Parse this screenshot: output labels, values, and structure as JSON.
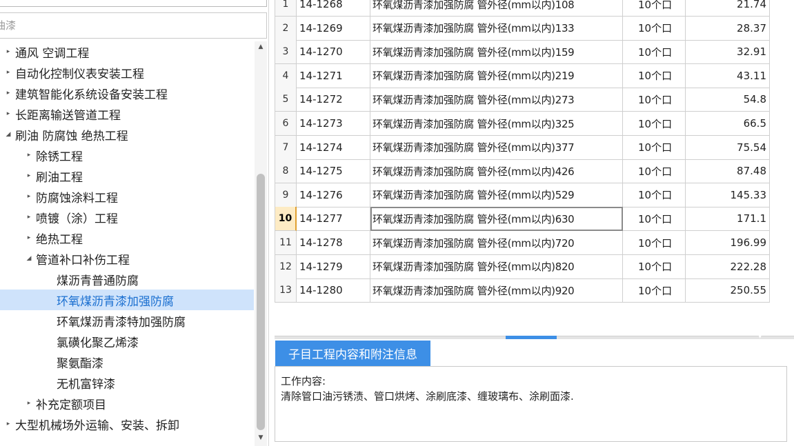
{
  "left_panel": {
    "filter_placeholder": "油漆",
    "tree": [
      {
        "label": "通风 空调工程",
        "arrow": "▸",
        "depth": 0,
        "selected": false
      },
      {
        "label": "自动化控制仪表安装工程",
        "arrow": "▸",
        "depth": 0,
        "selected": false
      },
      {
        "label": "建筑智能化系统设备安装工程",
        "arrow": "▸",
        "depth": 0,
        "selected": false
      },
      {
        "label": "长距离输送管道工程",
        "arrow": "▸",
        "depth": 0,
        "selected": false
      },
      {
        "label": "刷油 防腐蚀 绝热工程",
        "arrow": "◢",
        "depth": 0,
        "selected": false
      },
      {
        "label": "除锈工程",
        "arrow": "▸",
        "depth": 1,
        "selected": false
      },
      {
        "label": "刷油工程",
        "arrow": "▸",
        "depth": 1,
        "selected": false
      },
      {
        "label": "防腐蚀涂料工程",
        "arrow": "▸",
        "depth": 1,
        "selected": false
      },
      {
        "label": "喷镀（涂）工程",
        "arrow": "▸",
        "depth": 1,
        "selected": false
      },
      {
        "label": "绝热工程",
        "arrow": "▸",
        "depth": 1,
        "selected": false
      },
      {
        "label": "管道补口补伤工程",
        "arrow": "◢",
        "depth": 1,
        "selected": false
      },
      {
        "label": "煤沥青普通防腐",
        "arrow": "",
        "depth": 2,
        "selected": false
      },
      {
        "label": "环氧煤沥青漆加强防腐",
        "arrow": "",
        "depth": 2,
        "selected": true
      },
      {
        "label": "环氧煤沥青漆特加强防腐",
        "arrow": "",
        "depth": 2,
        "selected": false
      },
      {
        "label": "氯磺化聚乙烯漆",
        "arrow": "",
        "depth": 2,
        "selected": false
      },
      {
        "label": "聚氨酯漆",
        "arrow": "",
        "depth": 2,
        "selected": false
      },
      {
        "label": "无机富锌漆",
        "arrow": "",
        "depth": 2,
        "selected": false
      },
      {
        "label": "补充定额项目",
        "arrow": "▸",
        "depth": 1,
        "selected": false
      },
      {
        "label": "大型机械场外运输、安装、拆卸",
        "arrow": "▸",
        "depth": 0,
        "selected": false
      }
    ]
  },
  "table": {
    "active_row": 10,
    "rows": [
      {
        "idx": "1",
        "code": "14-1268",
        "name": "环氧煤沥青漆加强防腐 管外径(mm以内)108",
        "unit": "10个口",
        "price": "21.74"
      },
      {
        "idx": "2",
        "code": "14-1269",
        "name": "环氧煤沥青漆加强防腐 管外径(mm以内)133",
        "unit": "10个口",
        "price": "28.37"
      },
      {
        "idx": "3",
        "code": "14-1270",
        "name": "环氧煤沥青漆加强防腐 管外径(mm以内)159",
        "unit": "10个口",
        "price": "32.91"
      },
      {
        "idx": "4",
        "code": "14-1271",
        "name": "环氧煤沥青漆加强防腐 管外径(mm以内)219",
        "unit": "10个口",
        "price": "43.11"
      },
      {
        "idx": "5",
        "code": "14-1272",
        "name": "环氧煤沥青漆加强防腐 管外径(mm以内)273",
        "unit": "10个口",
        "price": "54.8"
      },
      {
        "idx": "6",
        "code": "14-1273",
        "name": "环氧煤沥青漆加强防腐 管外径(mm以内)325",
        "unit": "10个口",
        "price": "66.5"
      },
      {
        "idx": "7",
        "code": "14-1274",
        "name": "环氧煤沥青漆加强防腐 管外径(mm以内)377",
        "unit": "10个口",
        "price": "75.54"
      },
      {
        "idx": "8",
        "code": "14-1275",
        "name": "环氧煤沥青漆加强防腐 管外径(mm以内)426",
        "unit": "10个口",
        "price": "87.48"
      },
      {
        "idx": "9",
        "code": "14-1276",
        "name": "环氧煤沥青漆加强防腐 管外径(mm以内)529",
        "unit": "10个口",
        "price": "145.33"
      },
      {
        "idx": "10",
        "code": "14-1277",
        "name": "环氧煤沥青漆加强防腐 管外径(mm以内)630",
        "unit": "10个口",
        "price": "171.1"
      },
      {
        "idx": "11",
        "code": "14-1278",
        "name": "环氧煤沥青漆加强防腐 管外径(mm以内)720",
        "unit": "10个口",
        "price": "196.99"
      },
      {
        "idx": "12",
        "code": "14-1279",
        "name": "环氧煤沥青漆加强防腐 管外径(mm以内)820",
        "unit": "10个口",
        "price": "222.28"
      },
      {
        "idx": "13",
        "code": "14-1280",
        "name": "环氧煤沥青漆加强防腐 管外径(mm以内)920",
        "unit": "10个口",
        "price": "250.55"
      }
    ]
  },
  "info": {
    "tab_label": "子目工程内容和附注信息",
    "work_title": "工作内容:",
    "work_text": "清除管口油污锈渍、管口烘烤、涂刷底漆、缠玻璃布、涂刷面漆."
  },
  "icons": {
    "scroll_up": "▲",
    "scroll_down": "▼",
    "splitter": "▼"
  },
  "colors": {
    "accent": "#3d8fe6",
    "selected_row_bg": "#cfe3fb",
    "active_index_bg": "#fdebc4"
  }
}
